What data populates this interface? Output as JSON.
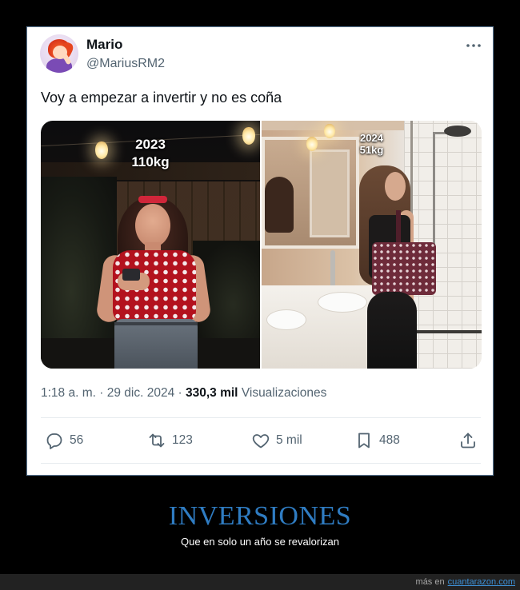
{
  "colors": {
    "page_background": "#000000",
    "card_background": "#ffffff",
    "card_border": "#5a7896",
    "primary_text": "#0f1419",
    "secondary_text": "#536471",
    "caption_title": "#2f7cc2",
    "caption_subtitle": "#ffffff",
    "footer_background": "#222222",
    "footer_link": "#3d8fd4"
  },
  "tweet": {
    "author": {
      "name": "Mario",
      "handle": "@MariusRM2",
      "avatar": "cartoon-avatar"
    },
    "more_icon": "more-horizontal-icon",
    "text": "Voy a empezar a invertir y no es coña",
    "media": {
      "before": {
        "year": "2023",
        "weight": "110kg"
      },
      "after": {
        "year": "2024",
        "weight": "51kg"
      }
    },
    "meta": {
      "time": "1:18 a. m.",
      "separator": "·",
      "date": "29 dic. 2024",
      "views_count": "330,3 mil",
      "views_label": "Visualizaciones"
    },
    "actions": {
      "reply": {
        "icon": "reply-icon",
        "count": "56"
      },
      "retweet": {
        "icon": "retweet-icon",
        "count": "123"
      },
      "like": {
        "icon": "heart-icon",
        "count": "5 mil"
      },
      "bookmark": {
        "icon": "bookmark-icon",
        "count": "488"
      },
      "share": {
        "icon": "share-icon"
      }
    }
  },
  "caption": {
    "title": "INVERSIONES",
    "subtitle": "Que en solo un año se revalorizan"
  },
  "footer": {
    "prefix": "más en",
    "link": "cuantarazon.com"
  }
}
